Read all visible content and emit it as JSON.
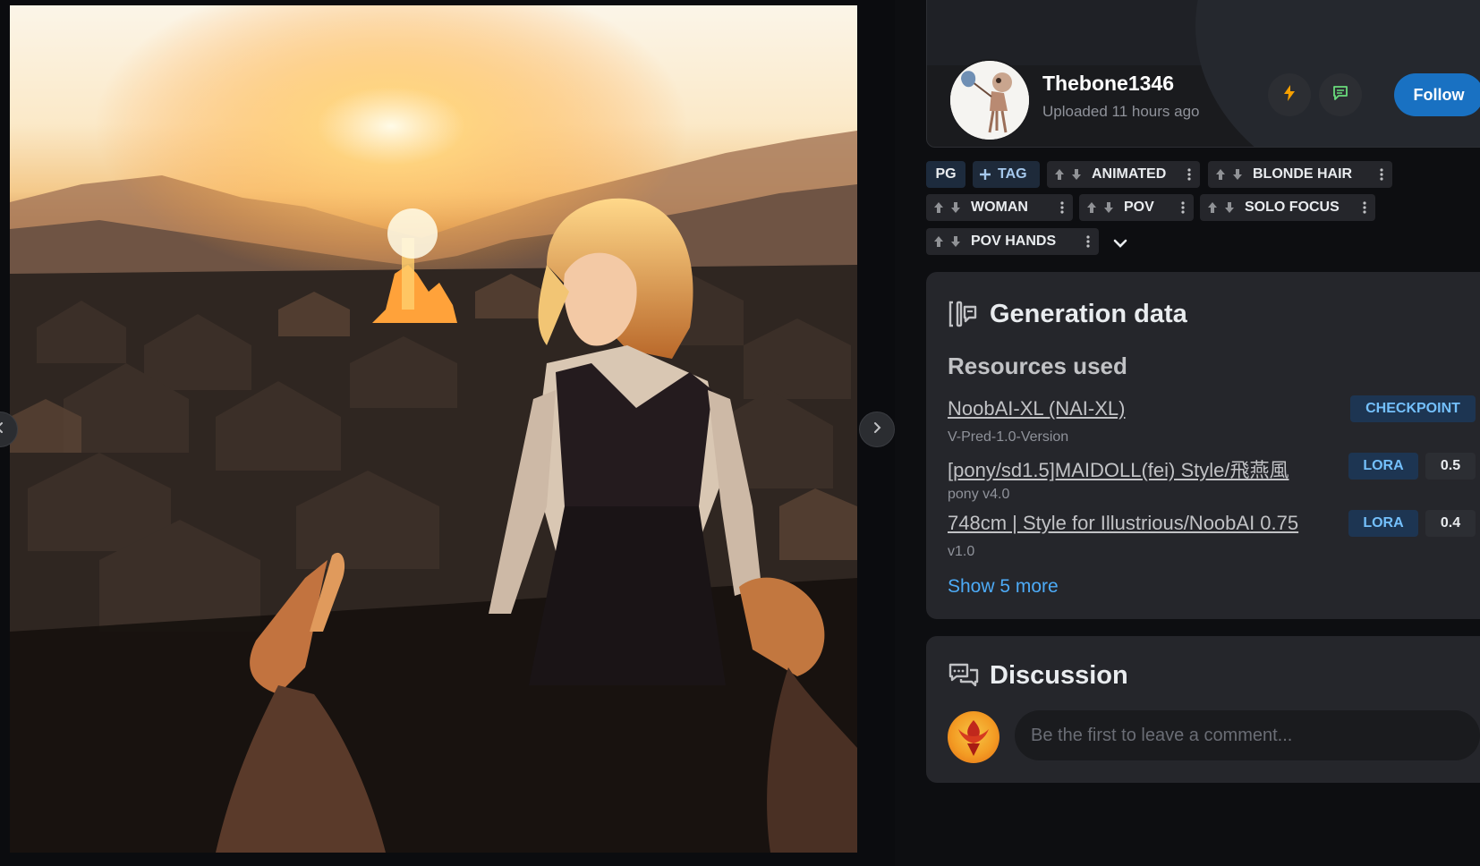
{
  "viewer": {
    "image_alt": "",
    "prev_icon": "chevron-left-icon",
    "next_icon": "chevron-right-icon"
  },
  "user": {
    "name": "Thebone1346",
    "uploaded": "Uploaded 11 hours ago",
    "tip_icon": "lightning-icon",
    "message_icon": "message-icon",
    "follow_label": "Follow"
  },
  "tags": {
    "rating": "PG",
    "add_label": "TAG",
    "items": [
      "ANIMATED",
      "BLONDE HAIR",
      "WOMAN",
      "POV",
      "SOLO FOCUS",
      "POV HANDS"
    ]
  },
  "generation": {
    "title": "Generation data",
    "resources_heading": "Resources used",
    "resources": [
      {
        "name": "NoobAI-XL (NAI-XL)",
        "version": "V-Pred-1.0-Version",
        "type": "CHECKPOINT",
        "weight": ""
      },
      {
        "name": "[pony/sd1.5]MAIDOLL(fei) Style/飛燕風",
        "version": "pony v4.0",
        "type": "LORA",
        "weight": "0.5"
      },
      {
        "name": "748cm | Style for Illustrious/NoobAI 0.75",
        "version": "v1.0",
        "type": "LORA",
        "weight": "0.4"
      }
    ],
    "show_more": "Show 5 more"
  },
  "discussion": {
    "title": "Discussion",
    "placeholder": "Be the first to leave a comment..."
  },
  "colors": {
    "accent": "#1971c2",
    "link": "#4dabf7",
    "tip": "#f59f00",
    "card": "#25262b"
  }
}
